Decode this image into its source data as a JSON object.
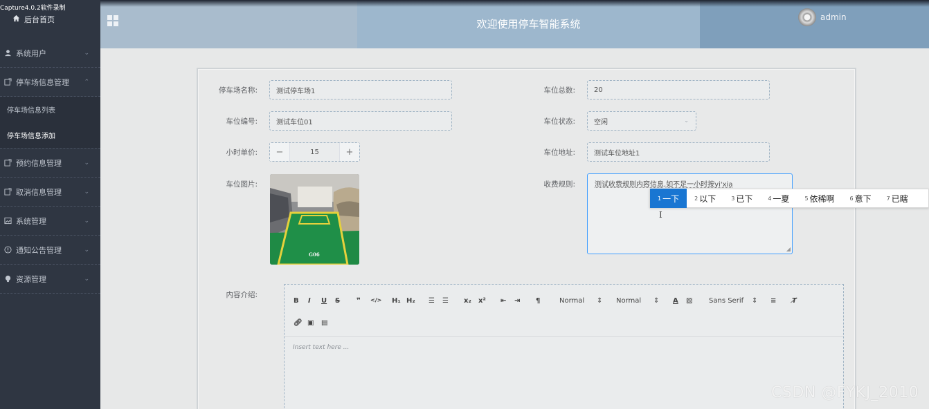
{
  "capture_label": "Capture4.0.2软件录制",
  "sidebar": {
    "home": "后台首页",
    "items": [
      {
        "label": "系统用户",
        "icon": "user-icon"
      },
      {
        "label": "停车场信息管理",
        "icon": "edit-box-icon",
        "expanded": true,
        "children": [
          {
            "label": "停车场信息列表"
          },
          {
            "label": "停车场信息添加",
            "active": true
          }
        ]
      },
      {
        "label": "预约信息管理",
        "icon": "edit-box-icon"
      },
      {
        "label": "取消信息管理",
        "icon": "edit-box-icon"
      },
      {
        "label": "系统管理",
        "icon": "picture-icon"
      },
      {
        "label": "通知公告管理",
        "icon": "info-circle-icon"
      },
      {
        "label": "资源管理",
        "icon": "bulb-icon"
      }
    ]
  },
  "header": {
    "title": "欢迎使用停车智能系统",
    "user": "admin"
  },
  "form": {
    "name_label": "停车场名称:",
    "name_value": "测试停车场1",
    "total_label": "车位总数:",
    "total_value": "20",
    "code_label": "车位编号:",
    "code_value": "测试车位01",
    "status_label": "车位状态:",
    "status_value": "空闲",
    "price_label": "小时单价:",
    "price_value": "15",
    "price_minus": "−",
    "price_plus": "+",
    "address_label": "车位地址:",
    "address_value": "测试车位地址1",
    "image_label": "车位图片:",
    "image_plate": "G06",
    "rules_label": "收费规则:",
    "rules_value": "测试收费规则内容信息,如不足一小时按yi'xia",
    "content_label": "内容介绍:"
  },
  "ime": {
    "candidates": [
      {
        "n": "1",
        "text": "一下"
      },
      {
        "n": "2",
        "text": "以下"
      },
      {
        "n": "3",
        "text": "已下"
      },
      {
        "n": "4",
        "text": "一夏"
      },
      {
        "n": "5",
        "text": "依稀啊"
      },
      {
        "n": "6",
        "text": "意下"
      },
      {
        "n": "7",
        "text": "已瞎"
      }
    ],
    "selected": 0
  },
  "editor": {
    "placeholder": "Insert text here ...",
    "header_select": "Normal",
    "size_select": "Normal",
    "font_select": "Sans Serif",
    "toolbar_buttons": [
      "bold",
      "italic",
      "underline",
      "strike",
      "blockquote",
      "code-block",
      "header-1",
      "header-2",
      "ordered-list",
      "bullet-list",
      "subscript",
      "superscript",
      "outdent",
      "indent",
      "rtl",
      "color",
      "background",
      "align",
      "clean",
      "link",
      "image",
      "video"
    ]
  },
  "watermark": "CSDN @FYKJ_2010",
  "colors": {
    "sidebar_bg": "#2f3642",
    "header_bg": "#a9bccd",
    "ime_selected": "#1976d2",
    "focus_border": "#409eff"
  }
}
